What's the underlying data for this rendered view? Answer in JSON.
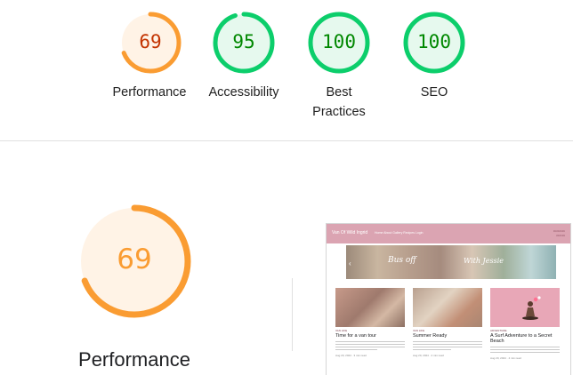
{
  "scores": [
    {
      "value": "69",
      "label": "Performance",
      "score": 69,
      "ring_color": "#fa9c32",
      "bg_color": "#fff3e6",
      "text_color": "#c33300"
    },
    {
      "value": "95",
      "label": "Accessibility",
      "score": 95,
      "ring_color": "#0cce6b",
      "bg_color": "#e6f9ee",
      "text_color": "#008800"
    },
    {
      "value": "100",
      "label": "Best Practices",
      "label_line1": "Best",
      "label_line2": "Practices",
      "score": 100,
      "ring_color": "#0cce6b",
      "bg_color": "#e6f9ee",
      "text_color": "#008800"
    },
    {
      "value": "100",
      "label": "SEO",
      "score": 100,
      "ring_color": "#0cce6b",
      "bg_color": "#e6f9ee",
      "text_color": "#008800"
    }
  ],
  "detail": {
    "value": "69",
    "label": "Performance",
    "score": 69,
    "ring_color": "#fa9c32",
    "bg_color": "#fff3e6",
    "text_color": "#fa9c32"
  },
  "screenshot": {
    "logo": "Van Of Wild Ingrid",
    "nav": "Home   About   Gallery   Recipes   Login",
    "banner_left": "Bus off",
    "banner_right": "With Jessie",
    "cards": [
      {
        "title": "Time for a van tour",
        "tag": "VAN LIFE",
        "date": "Aug 20, 2024 · 3 min read"
      },
      {
        "title": "Summer Ready",
        "tag": "VAN LIFE",
        "date": "Aug 20, 2024 · 2 min read"
      },
      {
        "title": "A Surf Adventure to a Secret Beach",
        "tag": "ADVENTURE",
        "date": "Aug 20, 2024 · 4 min read"
      }
    ]
  }
}
